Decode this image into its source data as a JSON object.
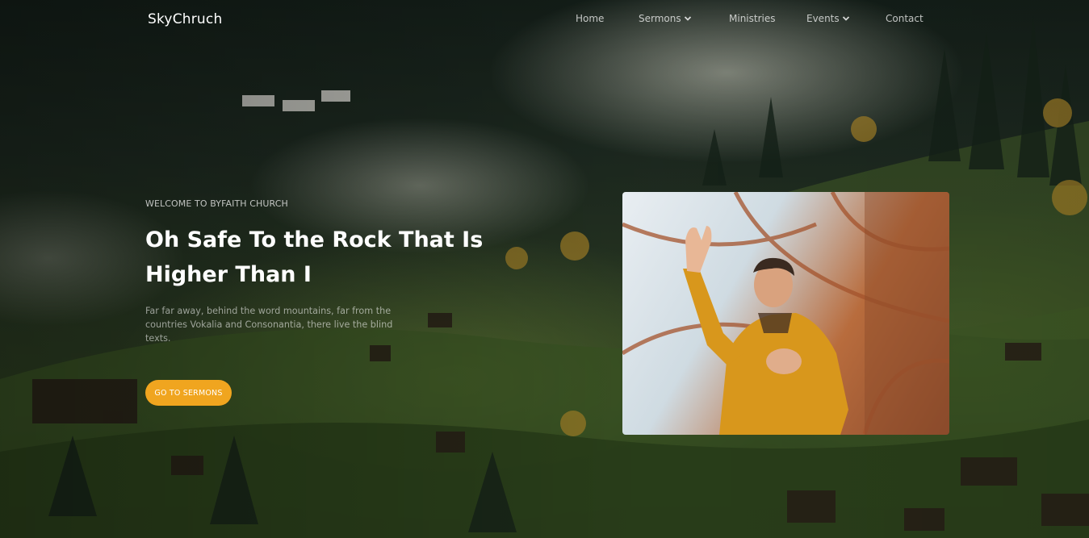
{
  "brand": "SkyChruch",
  "nav": [
    {
      "label": "Home",
      "icon": null
    },
    {
      "label": "Sermons",
      "icon": "chevron-down-icon"
    },
    {
      "label": "Ministries",
      "icon": null
    },
    {
      "label": "Events",
      "icon": "chevron-down-icon"
    },
    {
      "label": "Contact",
      "icon": null
    }
  ],
  "hero": {
    "eyebrow": "WELCOME TO BYFAITH CHURCH",
    "headline": "Oh Safe To the Rock That Is Higher Than I",
    "description": "Far far away, behind the word mountains, far from the countries Vokalia and Consonantia, there live the blind texts.",
    "cta_label": "GO TO SERMONS"
  },
  "colors": {
    "accent": "#f0a51f",
    "text_primary": "#ffffff"
  }
}
